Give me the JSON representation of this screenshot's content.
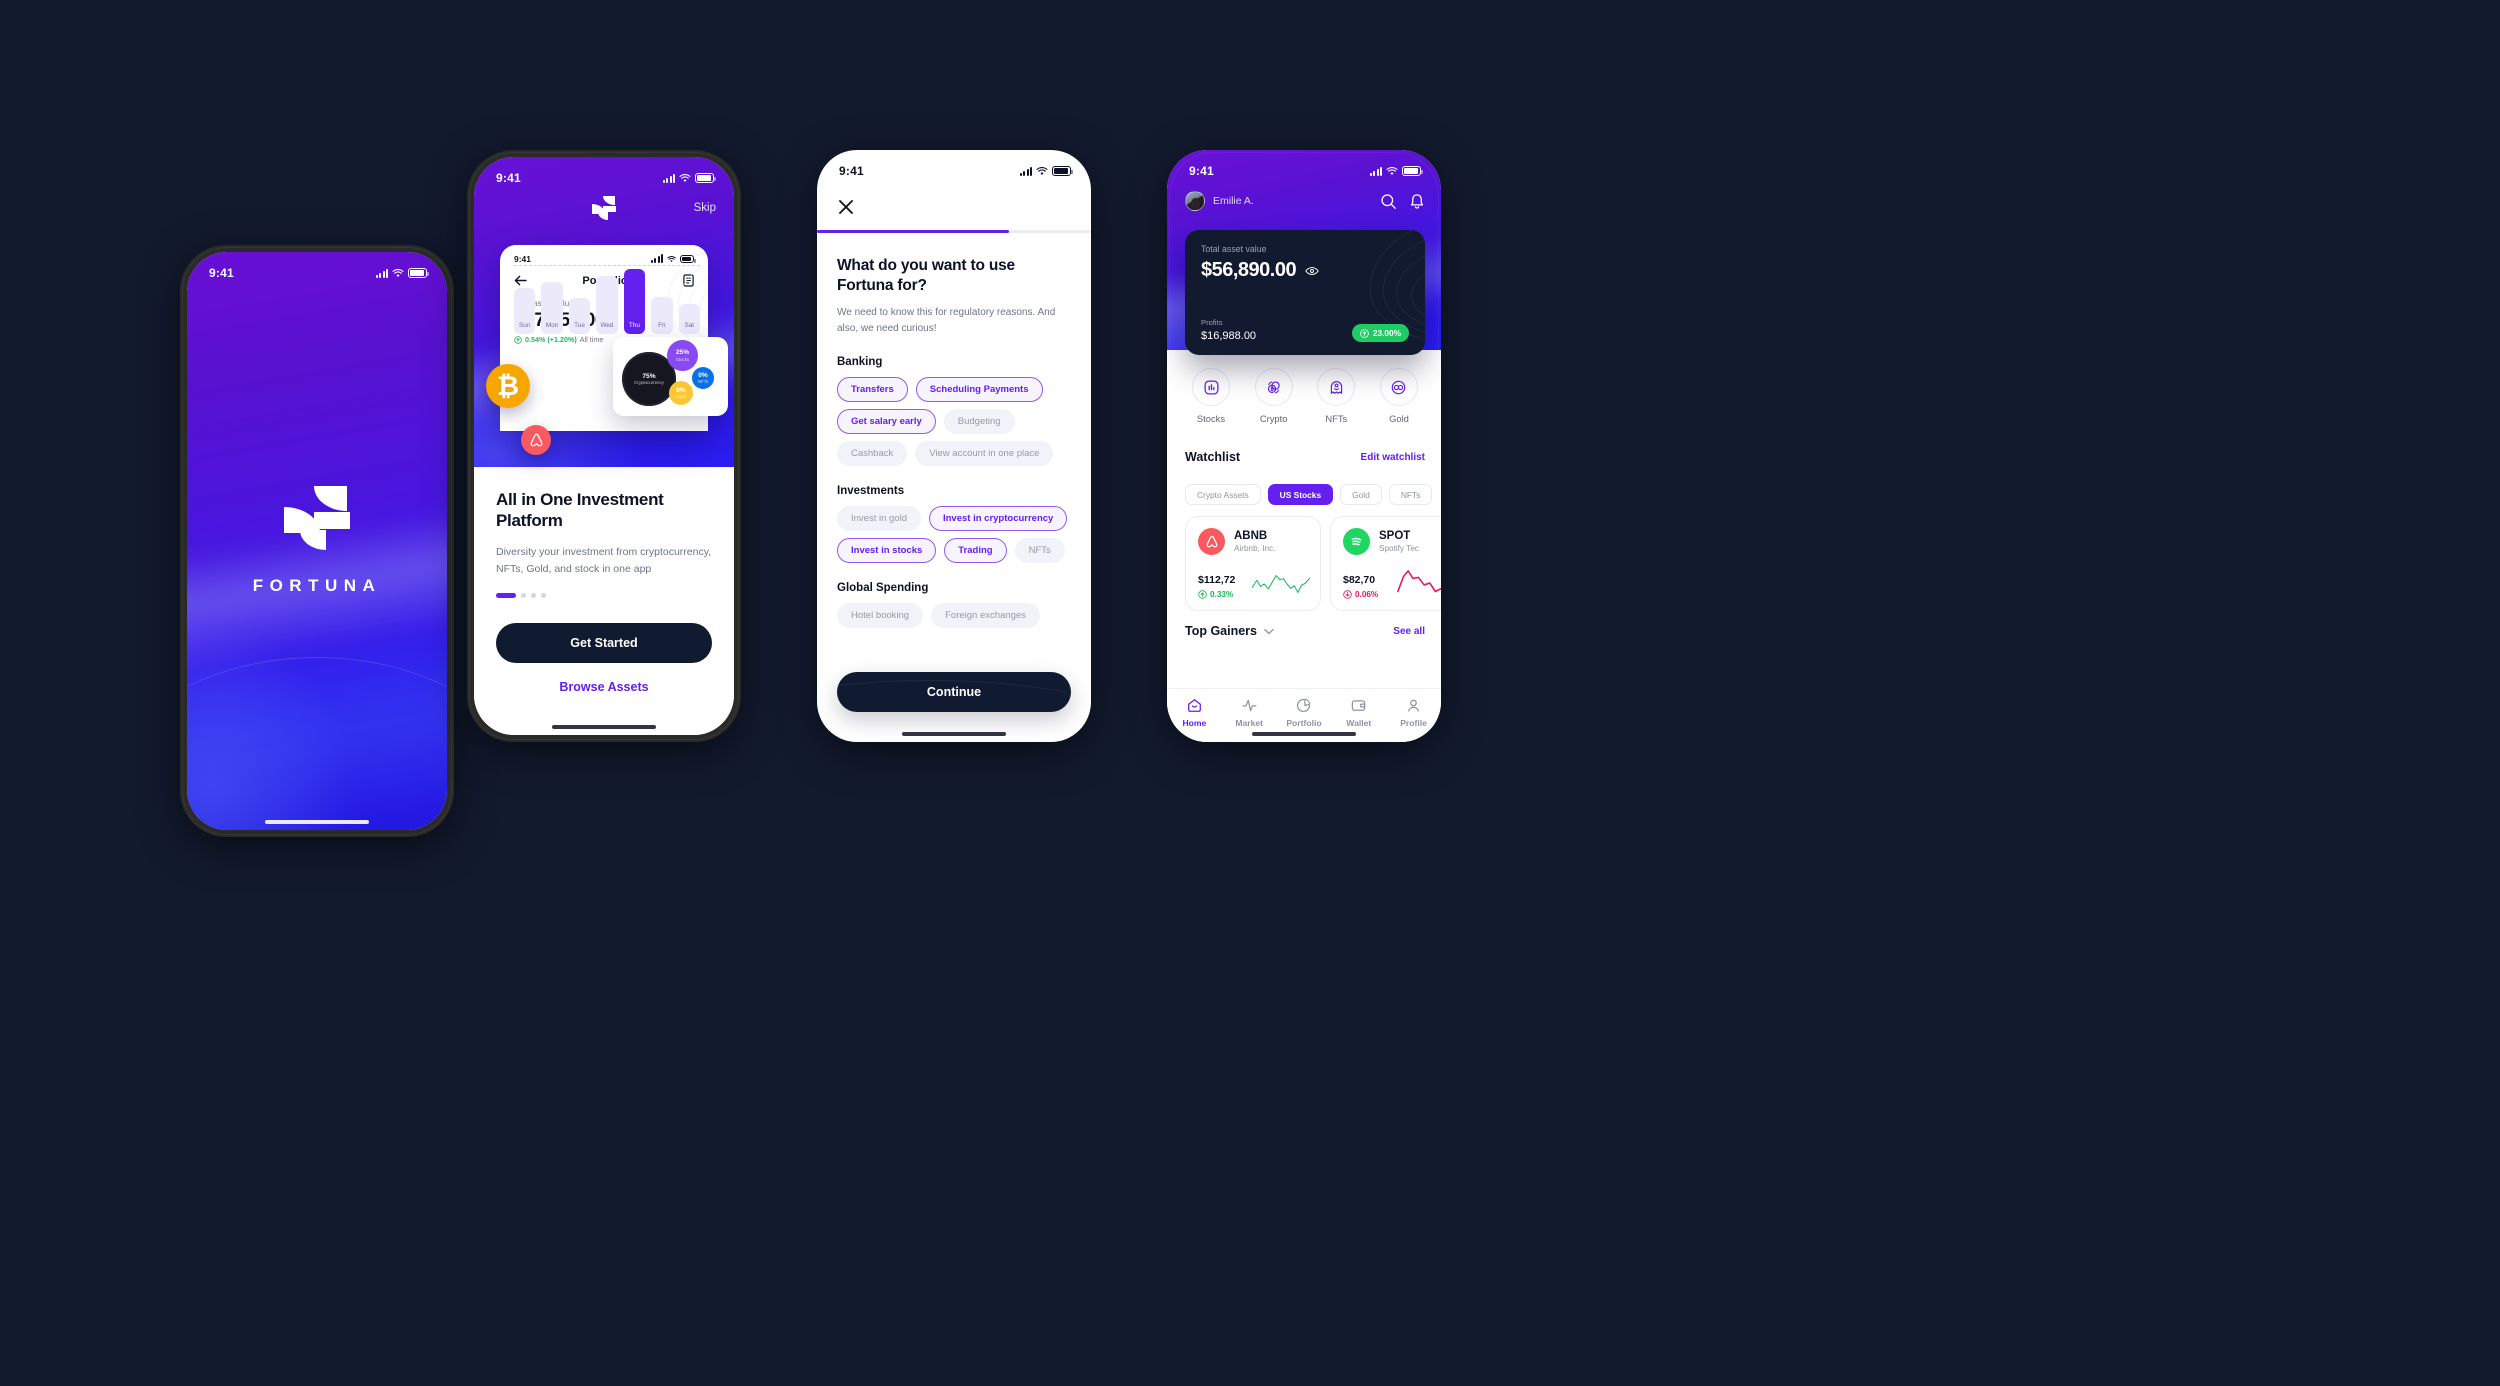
{
  "brand": {
    "name": "FORTUNA",
    "accent": "#6320ee",
    "dark": "#101a31",
    "bg": "#121a2e"
  },
  "phone1": {
    "status": {
      "time": "9:41"
    },
    "wordmark": "FORTUNA"
  },
  "phone2": {
    "status": {
      "time": "9:41"
    },
    "skip_label": "Skip",
    "mock": {
      "status_time": "9:41",
      "nav_title": "Portfolio",
      "asset_label": "Total asset value",
      "asset_value": "$27,456.00",
      "delta_value": "0.54% (+1.20%)",
      "delta_period": "All time",
      "chart": {
        "days": [
          "Sun",
          "Mon",
          "Tue",
          "Wed",
          "Thu",
          "Fri",
          "Sat"
        ],
        "heights": [
          62,
          70,
          48,
          78,
          88,
          50,
          40
        ],
        "active_index": 4
      },
      "bubbles": [
        {
          "pct": "75%",
          "label": "Cryptocurrency",
          "color": "#15161f"
        },
        {
          "pct": "25%",
          "label": "Stocks",
          "color": "#8a4af3"
        },
        {
          "pct": "0%",
          "label": "NFTs",
          "color": "#0a6fe8"
        },
        {
          "pct": "0%",
          "label": "Gold",
          "color": "#fcc734"
        }
      ],
      "coins": [
        {
          "name": "bitcoin-coin",
          "glyph": "₿",
          "color": "#f7a600"
        },
        {
          "name": "airbnb-coin",
          "glyph": "",
          "color": "#fa5a5f"
        }
      ]
    },
    "title": "All in One Investment Platform",
    "subtitle": "Diversity your investment from cryptocurrency, NFTs, Gold, and stock in one app",
    "pager": {
      "total": 4,
      "active": 0
    },
    "primary_cta": "Get Started",
    "secondary_cta": "Browse Assets"
  },
  "phone3": {
    "status": {
      "time": "9:41"
    },
    "progress_pct": 70,
    "title": "What do you want to use Fortuna for?",
    "subtitle": "We need to know this for regulatory reasons. And also, we need curious!",
    "groups": [
      {
        "name": "Banking",
        "chips": [
          {
            "label": "Transfers",
            "selected": true
          },
          {
            "label": "Scheduling Payments",
            "selected": true
          },
          {
            "label": "Get salary early",
            "selected": true
          },
          {
            "label": "Budgeting",
            "selected": false
          },
          {
            "label": "Cashback",
            "selected": false
          },
          {
            "label": "View account in one place",
            "selected": false
          }
        ]
      },
      {
        "name": "Investments",
        "chips": [
          {
            "label": "Invest in gold",
            "selected": false
          },
          {
            "label": "Invest in cryptocurrency",
            "selected": true
          },
          {
            "label": "Invest in stocks",
            "selected": true
          },
          {
            "label": "Trading",
            "selected": true
          },
          {
            "label": "NFTs",
            "selected": false
          }
        ]
      },
      {
        "name": "Global Spending",
        "chips": [
          {
            "label": "Hotel booking",
            "selected": false
          },
          {
            "label": "Foreign exchanges",
            "selected": false
          }
        ]
      }
    ],
    "cta": "Continue"
  },
  "phone4": {
    "status": {
      "time": "9:41"
    },
    "user_name": "Emilie A.",
    "asset_label": "Total asset value",
    "asset_value": "$56,890.00",
    "profits_label": "Profits",
    "profits_value": "$16,988.00",
    "profits_badge": "23.00%",
    "categories": [
      {
        "label": "Stocks",
        "icon": "stocks-icon"
      },
      {
        "label": "Crypto",
        "icon": "crypto-icon"
      },
      {
        "label": "NFTs",
        "icon": "nfts-icon"
      },
      {
        "label": "Gold",
        "icon": "gold-icon"
      }
    ],
    "watchlist_title": "Watchlist",
    "watchlist_edit": "Edit watchlist",
    "watchlist_tabs": [
      {
        "label": "Crypto Assets",
        "active": false
      },
      {
        "label": "US Stocks",
        "active": true
      },
      {
        "label": "Gold",
        "active": false
      },
      {
        "label": "NFTs",
        "active": false
      }
    ],
    "watchlist_cards": [
      {
        "symbol": "ABNB",
        "name": "Airbnb, Inc.",
        "price": "$112,72",
        "change": "0.33%",
        "direction": "up",
        "color": "#fa5a5f",
        "logo": "airbnb-logo"
      },
      {
        "symbol": "SPOT",
        "name": "Spotify Tec",
        "price": "$82,70",
        "change": "0.06%",
        "direction": "down",
        "color": "#1ed760",
        "logo": "spotify-logo"
      }
    ],
    "gainers_title": "Top Gainers",
    "gainers_link": "See all",
    "tabbar": [
      {
        "label": "Home",
        "icon": "home-icon",
        "active": true
      },
      {
        "label": "Market",
        "icon": "pulse-icon",
        "active": false
      },
      {
        "label": "Portfolio",
        "icon": "pie-icon",
        "active": false
      },
      {
        "label": "Wallet",
        "icon": "wallet-icon",
        "active": false
      },
      {
        "label": "Profile",
        "icon": "person-icon",
        "active": false
      }
    ]
  }
}
